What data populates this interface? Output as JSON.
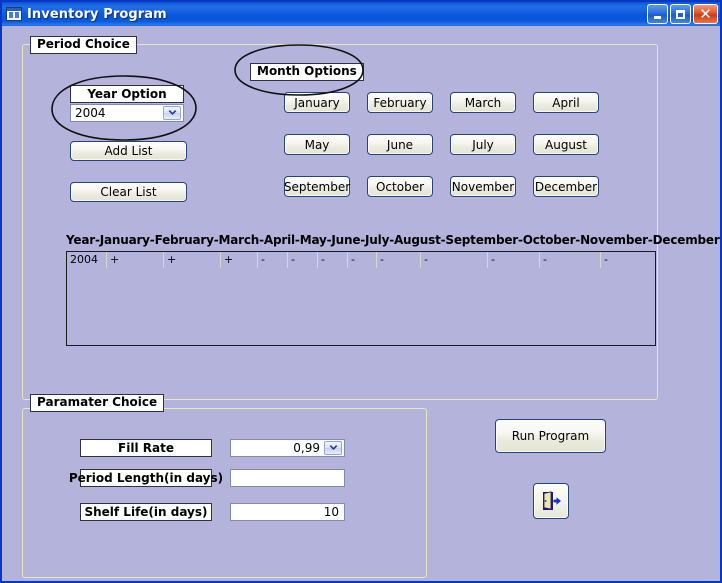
{
  "window": {
    "title": "Inventory Program",
    "icon": "form-grid-icon",
    "controls": {
      "minimize": "minimize-button",
      "maximize": "maximize-button",
      "close": "close-button"
    },
    "colors": {
      "titlebar_blue": "#1160e2",
      "client_background": "#b3b3db",
      "groupbox_border": "#e8e8c0",
      "button_border": "#26447a",
      "close_red": "#e2542a"
    }
  },
  "period_choice": {
    "legend": "Period Choice",
    "year_option": {
      "label": "Year Option",
      "selected": "2004",
      "arrow_icon": "chevron-down-icon"
    },
    "add_list_label": "Add List",
    "clear_list_label": "Clear List",
    "month_options": {
      "legend": "Month Options",
      "months": [
        "January",
        "February",
        "March",
        "April",
        "May",
        "June",
        "July",
        "August",
        "September",
        "October",
        "November",
        "December"
      ]
    },
    "list": {
      "header_text": "Year-January-February-March-April-May-June-July-August-September-October-November-December",
      "columns": [
        "Year",
        "January",
        "February",
        "March",
        "April",
        "May",
        "June",
        "July",
        "August",
        "September",
        "October",
        "November",
        "December"
      ],
      "rows": [
        [
          "2004",
          "+",
          "+",
          "+",
          "-",
          "-",
          "-",
          "-",
          "-",
          "-",
          "-",
          "-",
          "-"
        ]
      ]
    }
  },
  "parameter_choice": {
    "legend": "Paramater Choice",
    "fields": [
      {
        "label": "Fill Rate",
        "value": "0,99",
        "control": "combo"
      },
      {
        "label": "Period Length(in days)",
        "value": "",
        "control": "textbox"
      },
      {
        "label": "Shelf Life(in days)",
        "value": "10",
        "control": "textbox"
      }
    ]
  },
  "actions": {
    "run_program_label": "Run Program",
    "exit_icon": "exit-door-icon"
  },
  "annotations": {
    "year_ellipse": "hand-drawn-ellipse",
    "month_ellipse": "hand-drawn-ellipse"
  }
}
